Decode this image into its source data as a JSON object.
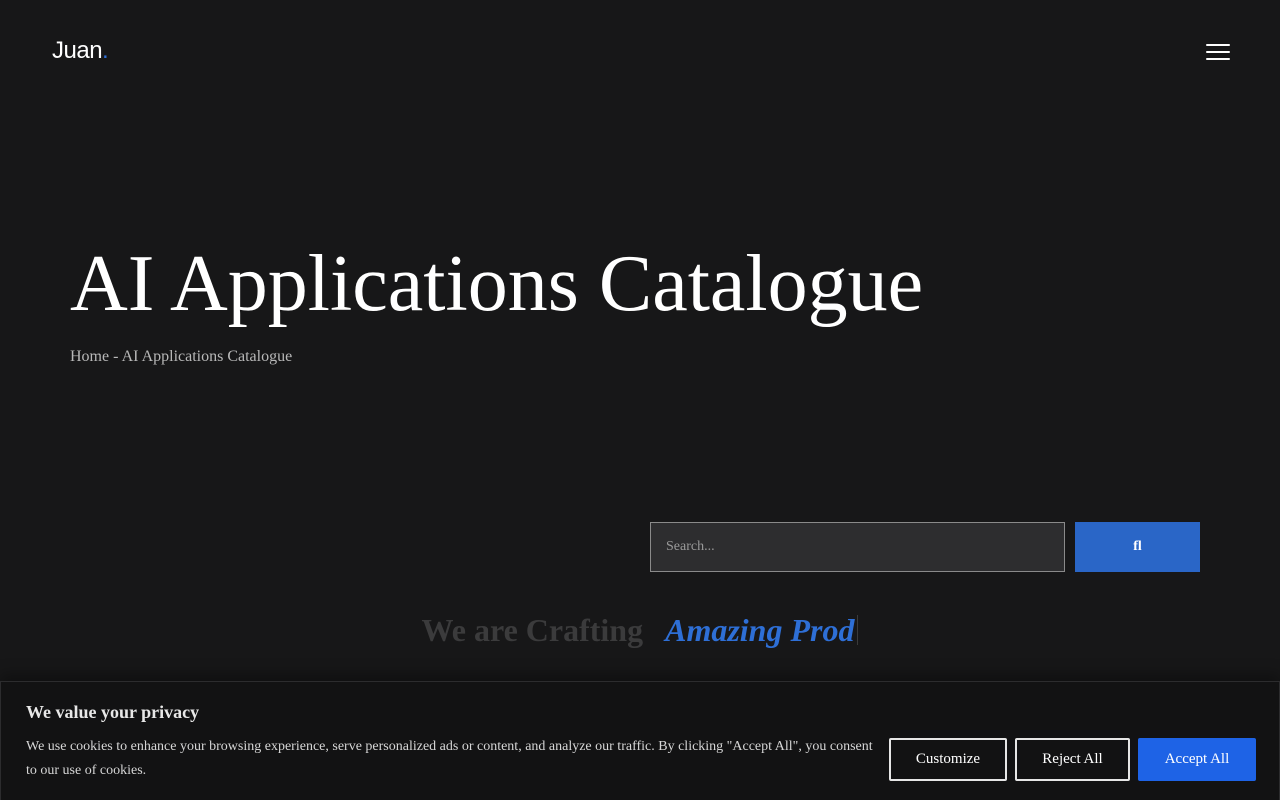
{
  "header": {
    "logo_text": "Juan",
    "logo_dot": ".",
    "menu_icon": "hamburger-menu-icon"
  },
  "hero": {
    "title": "AI Applications Catalogue",
    "breadcrumb": {
      "home": "Home",
      "separator": " - ",
      "current": "AI Applications Catalogue"
    }
  },
  "search": {
    "placeholder": "Search...",
    "button_label": "fl"
  },
  "tagline": {
    "static_text": "We are Crafting",
    "typed_text": "Amazing Prod"
  },
  "cookie_banner": {
    "title": "We value your privacy",
    "text": "We use cookies to enhance your browsing experience, serve personalized ads or content, and analyze our traffic. By clicking \"Accept All\", you consent to our use of cookies.",
    "customize_label": "Customize",
    "reject_label": "Reject All",
    "accept_label": "Accept All"
  },
  "colors": {
    "background": "#171718",
    "accent": "#2e6fd6",
    "accept_button": "#1e63e6"
  }
}
